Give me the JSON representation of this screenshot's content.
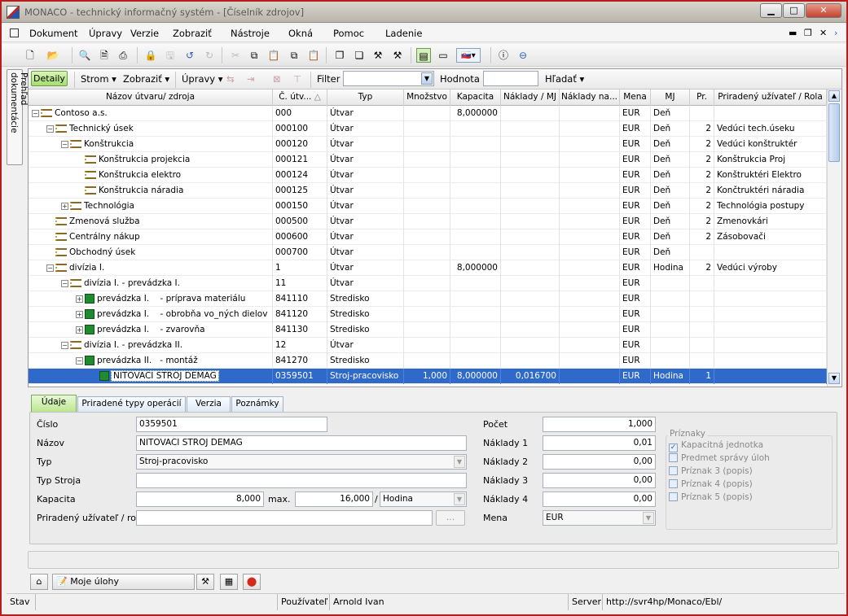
{
  "window": {
    "title": "MONACO - technický informačný systém - [Číselník zdrojov]"
  },
  "menu": [
    "Dokument",
    "Úpravy",
    "Verzie",
    "Zobraziť",
    "Nástroje",
    "Okná",
    "Pomoc",
    "Ladenie"
  ],
  "sidebar": {
    "tab": "Prehľad dokumentácie"
  },
  "subtoolbar": {
    "detail": "Detaily",
    "strom": "Strom",
    "zobrazit": "Zobraziť",
    "upravy": "Úpravy",
    "filter_label": "Filter",
    "filter_value": "",
    "hodnota_label": "Hodnota",
    "hodnota_value": "",
    "hladat": "Hľadať"
  },
  "grid": {
    "columns": [
      "Názov útvaru/ zdroja",
      "Č. útv...",
      "Typ",
      "Množstvo",
      "Kapacita",
      "Náklady / MJ",
      "Náklady na...",
      "Mena",
      "MJ",
      "Pr.",
      "Priradený užívateľ / Rola"
    ],
    "rows": [
      {
        "level": 0,
        "exp": "−",
        "icon": "org",
        "name": "Contoso a.s.",
        "cislo": "000",
        "typ": "Útvar",
        "mnozstvo": "",
        "kapacita": "8,000000",
        "naklady": "",
        "nakladyna": "",
        "mena": "EUR",
        "mj": "Deň",
        "pr": "",
        "uzivatel": ""
      },
      {
        "level": 1,
        "exp": "−",
        "icon": "org",
        "name": "Technický úsek",
        "cislo": "000100",
        "typ": "Útvar",
        "mnozstvo": "",
        "kapacita": "",
        "naklady": "",
        "nakladyna": "",
        "mena": "EUR",
        "mj": "Deň",
        "pr": "2",
        "uzivatel": "Vedúci tech.úseku"
      },
      {
        "level": 2,
        "exp": "−",
        "icon": "org",
        "name": "Konštrukcia",
        "cislo": "000120",
        "typ": "Útvar",
        "mnozstvo": "",
        "kapacita": "",
        "naklady": "",
        "nakladyna": "",
        "mena": "EUR",
        "mj": "Deň",
        "pr": "2",
        "uzivatel": "Vedúci konštruktér"
      },
      {
        "level": 3,
        "exp": "",
        "icon": "org",
        "name": "Konštrukcia projekcia",
        "cislo": "000121",
        "typ": "Útvar",
        "mnozstvo": "",
        "kapacita": "",
        "naklady": "",
        "nakladyna": "",
        "mena": "EUR",
        "mj": "Deň",
        "pr": "2",
        "uzivatel": "Konštrukcia Proj"
      },
      {
        "level": 3,
        "exp": "",
        "icon": "org",
        "name": "Konštrukcia elektro",
        "cislo": "000124",
        "typ": "Útvar",
        "mnozstvo": "",
        "kapacita": "",
        "naklady": "",
        "nakladyna": "",
        "mena": "EUR",
        "mj": "Deň",
        "pr": "2",
        "uzivatel": "Konštruktéri Elektro"
      },
      {
        "level": 3,
        "exp": "",
        "icon": "org",
        "name": "Konštrukcia náradia",
        "cislo": "000125",
        "typ": "Útvar",
        "mnozstvo": "",
        "kapacita": "",
        "naklady": "",
        "nakladyna": "",
        "mena": "EUR",
        "mj": "Deň",
        "pr": "2",
        "uzivatel": "Končtruktéri náradia"
      },
      {
        "level": 2,
        "exp": "+",
        "icon": "org",
        "name": "Technológia",
        "cislo": "000150",
        "typ": "Útvar",
        "mnozstvo": "",
        "kapacita": "",
        "naklady": "",
        "nakladyna": "",
        "mena": "EUR",
        "mj": "Deň",
        "pr": "2",
        "uzivatel": "Technológia postupy"
      },
      {
        "level": 1,
        "exp": "",
        "icon": "org",
        "name": "Zmenová služba",
        "cislo": "000500",
        "typ": "Útvar",
        "mnozstvo": "",
        "kapacita": "",
        "naklady": "",
        "nakladyna": "",
        "mena": "EUR",
        "mj": "Deň",
        "pr": "2",
        "uzivatel": "Zmenovkári"
      },
      {
        "level": 1,
        "exp": "",
        "icon": "org",
        "name": "Centrálny nákup",
        "cislo": "000600",
        "typ": "Útvar",
        "mnozstvo": "",
        "kapacita": "",
        "naklady": "",
        "nakladyna": "",
        "mena": "EUR",
        "mj": "Deň",
        "pr": "2",
        "uzivatel": "Zásobovači"
      },
      {
        "level": 1,
        "exp": "",
        "icon": "org",
        "name": "Obchodný úsek",
        "cislo": "000700",
        "typ": "Útvar",
        "mnozstvo": "",
        "kapacita": "",
        "naklady": "",
        "nakladyna": "",
        "mena": "EUR",
        "mj": "Deň",
        "pr": "",
        "uzivatel": ""
      },
      {
        "level": 1,
        "exp": "−",
        "icon": "org",
        "name": "divízia I.",
        "cislo": "1",
        "typ": "Útvar",
        "mnozstvo": "",
        "kapacita": "8,000000",
        "naklady": "",
        "nakladyna": "",
        "mena": "EUR",
        "mj": "Hodina",
        "pr": "2",
        "uzivatel": "Vedúci výroby"
      },
      {
        "level": 2,
        "exp": "−",
        "icon": "org",
        "name": "divízia I. - prevádzka I.",
        "cislo": "11",
        "typ": "Útvar",
        "mnozstvo": "",
        "kapacita": "",
        "naklady": "",
        "nakladyna": "",
        "mena": "EUR",
        "mj": "",
        "pr": "",
        "uzivatel": ""
      },
      {
        "level": 3,
        "exp": "+",
        "icon": "wc",
        "name": "prevádzka I.    - príprava materiálu",
        "cislo": "841110",
        "typ": "Stredisko",
        "mnozstvo": "",
        "kapacita": "",
        "naklady": "",
        "nakladyna": "",
        "mena": "EUR",
        "mj": "",
        "pr": "",
        "uzivatel": ""
      },
      {
        "level": 3,
        "exp": "+",
        "icon": "wc",
        "name": "prevádzka I.    - obrobňa vo_ných dielov",
        "cislo": "841120",
        "typ": "Stredisko",
        "mnozstvo": "",
        "kapacita": "",
        "naklady": "",
        "nakladyna": "",
        "mena": "EUR",
        "mj": "",
        "pr": "",
        "uzivatel": ""
      },
      {
        "level": 3,
        "exp": "+",
        "icon": "wc",
        "name": "prevádzka I.    - zvarovňa",
        "cislo": "841130",
        "typ": "Stredisko",
        "mnozstvo": "",
        "kapacita": "",
        "naklady": "",
        "nakladyna": "",
        "mena": "EUR",
        "mj": "",
        "pr": "",
        "uzivatel": ""
      },
      {
        "level": 2,
        "exp": "−",
        "icon": "org",
        "name": "divízia I. - prevádzka II.",
        "cislo": "12",
        "typ": "Útvar",
        "mnozstvo": "",
        "kapacita": "",
        "naklady": "",
        "nakladyna": "",
        "mena": "EUR",
        "mj": "",
        "pr": "",
        "uzivatel": ""
      },
      {
        "level": 3,
        "exp": "−",
        "icon": "wc",
        "name": "prevádzka II.   - montáž",
        "cislo": "841270",
        "typ": "Stredisko",
        "mnozstvo": "",
        "kapacita": "",
        "naklady": "",
        "nakladyna": "",
        "mena": "EUR",
        "mj": "",
        "pr": "",
        "uzivatel": ""
      },
      {
        "level": 4,
        "exp": "",
        "icon": "wc",
        "name": "NITOVACI STROJ DEMAG",
        "cislo": "0359501",
        "typ": "Stroj-pracovisko",
        "mnozstvo": "1,000",
        "kapacita": "8,000000",
        "naklady": "0,016700",
        "nakladyna": "",
        "mena": "EUR",
        "mj": "Hodina",
        "pr": "1",
        "uzivatel": "",
        "selected": true
      }
    ]
  },
  "detail": {
    "tabs": [
      "Údaje",
      "Priradené typy operácií",
      "Verzia",
      "Poznámky"
    ],
    "cislo_label": "Číslo",
    "cislo": "0359501",
    "nazov_label": "Názov",
    "nazov": "NITOVACI STROJ DEMAG",
    "typ_label": "Typ",
    "typ": "Stroj-pracovisko",
    "typstroja_label": "Typ Stroja",
    "typstroja": "",
    "kapacita_label": "Kapacita",
    "kapacita": "8,000",
    "max_label": "max.",
    "max": "16,000",
    "slash": "/",
    "jednotka": "Hodina",
    "uzivatel_label": "Priradený užívateľ / rola",
    "uzivatel": "",
    "ellipsis": "...",
    "pocet_label": "Počet",
    "pocet": "1,000",
    "n1_label": "Náklady 1",
    "n1": "0,01",
    "n2_label": "Náklady 2",
    "n2": "0,00",
    "n3_label": "Náklady 3",
    "n3": "0,00",
    "n4_label": "Náklady 4",
    "n4": "0,00",
    "mena_label": "Mena",
    "mena": "EUR",
    "priznaky_title": "Príznaky",
    "priznaky": [
      {
        "label": "Kapacitná jednotka",
        "checked": true
      },
      {
        "label": "Predmet správy úloh",
        "checked": false
      },
      {
        "label": "Príznak 3 (popis)",
        "checked": false
      },
      {
        "label": "Príznak 4 (popis)",
        "checked": false
      },
      {
        "label": "Príznak 5 (popis)",
        "checked": false
      }
    ]
  },
  "taskbar": {
    "moje_ulohy": "Moje úlohy"
  },
  "status": {
    "stav": "Stav",
    "pouzivatel_label": "Používateľ",
    "pouzivatel": "Arnold Ivan",
    "server_label": "Server",
    "server": "http://svr4hp/Monaco/Ebl/"
  }
}
